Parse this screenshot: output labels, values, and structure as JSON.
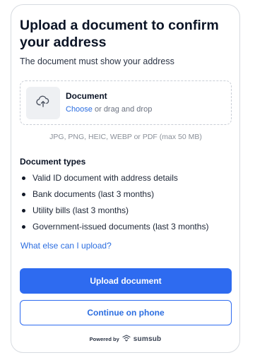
{
  "title": "Upload a document to confirm your address",
  "subtitle": "The document must show your address",
  "dropzone": {
    "label": "Document",
    "choose": "Choose",
    "hint_rest": " or drag and drop",
    "icon": "cloud-upload-icon"
  },
  "formats": "JPG, PNG, HEIC, WEBP or PDF (max 50 MB)",
  "document_types": {
    "heading": "Document types",
    "items": [
      "Valid ID document with address details",
      "Bank documents (last 3 months)",
      "Utility bills (last 3 months)",
      "Government-issued documents (last 3 months)"
    ]
  },
  "what_else_link": "What else can I upload?",
  "buttons": {
    "upload": "Upload document",
    "phone": "Continue on phone"
  },
  "footer": {
    "powered_by": "Powered by",
    "brand": "sumsub",
    "brand_icon": "sumsub-logo-icon"
  },
  "colors": {
    "accent": "#2e6bf0",
    "link": "#2b6de0"
  }
}
